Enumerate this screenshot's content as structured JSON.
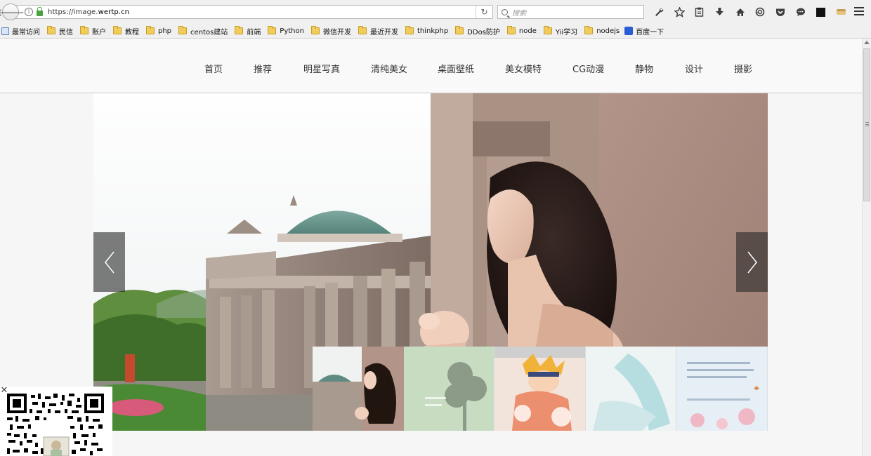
{
  "browser": {
    "url_prefix": "https://image.",
    "url_domain": "wertp.cn",
    "search_placeholder": "搜索",
    "toolbar_icons": [
      "wrench-icon",
      "star-icon",
      "reading-list-icon",
      "download-icon",
      "home-icon",
      "sync-icon",
      "pocket-icon",
      "chat-icon",
      "black-square-icon",
      "cake-icon"
    ],
    "back_glyph": "🡐",
    "reload_glyph": "↻"
  },
  "bookmarks": [
    {
      "label": "最常访问",
      "icon": "firstpage-icon"
    },
    {
      "label": "民信",
      "icon": "folder-icon"
    },
    {
      "label": "账户",
      "icon": "folder-icon"
    },
    {
      "label": "教程",
      "icon": "folder-icon"
    },
    {
      "label": "php",
      "icon": "folder-icon"
    },
    {
      "label": "centos建站",
      "icon": "folder-icon"
    },
    {
      "label": "前端",
      "icon": "folder-icon"
    },
    {
      "label": "Python",
      "icon": "folder-icon"
    },
    {
      "label": "微信开发",
      "icon": "folder-icon"
    },
    {
      "label": "最近开发",
      "icon": "folder-icon"
    },
    {
      "label": "thinkphp",
      "icon": "folder-icon"
    },
    {
      "label": "DDos防护",
      "icon": "folder-icon"
    },
    {
      "label": "node",
      "icon": "folder-icon"
    },
    {
      "label": "Yii学习",
      "icon": "folder-icon"
    },
    {
      "label": "nodejs",
      "icon": "folder-icon"
    },
    {
      "label": "百度一下",
      "icon": "baidu-icon"
    }
  ],
  "nav": [
    {
      "label": "首页",
      "key": "home"
    },
    {
      "label": "推荐",
      "key": "recommend"
    },
    {
      "label": "明星写真",
      "key": "star-photos"
    },
    {
      "label": "清纯美女",
      "key": "pure-beauty"
    },
    {
      "label": "桌面壁纸",
      "key": "wallpaper"
    },
    {
      "label": "美女模特",
      "key": "models"
    },
    {
      "label": "CG动漫",
      "key": "cg-anime"
    },
    {
      "label": "静物",
      "key": "still-life"
    },
    {
      "label": "设计",
      "key": "design"
    },
    {
      "label": "摄影",
      "key": "photography"
    }
  ],
  "slider": {
    "active_index": 0,
    "thumbnail_count": 5
  },
  "qr_popup": {
    "close_glyph": "✕"
  },
  "colors": {
    "accent_green": "#4aa33f",
    "nav_border": "#cdcdcd"
  }
}
